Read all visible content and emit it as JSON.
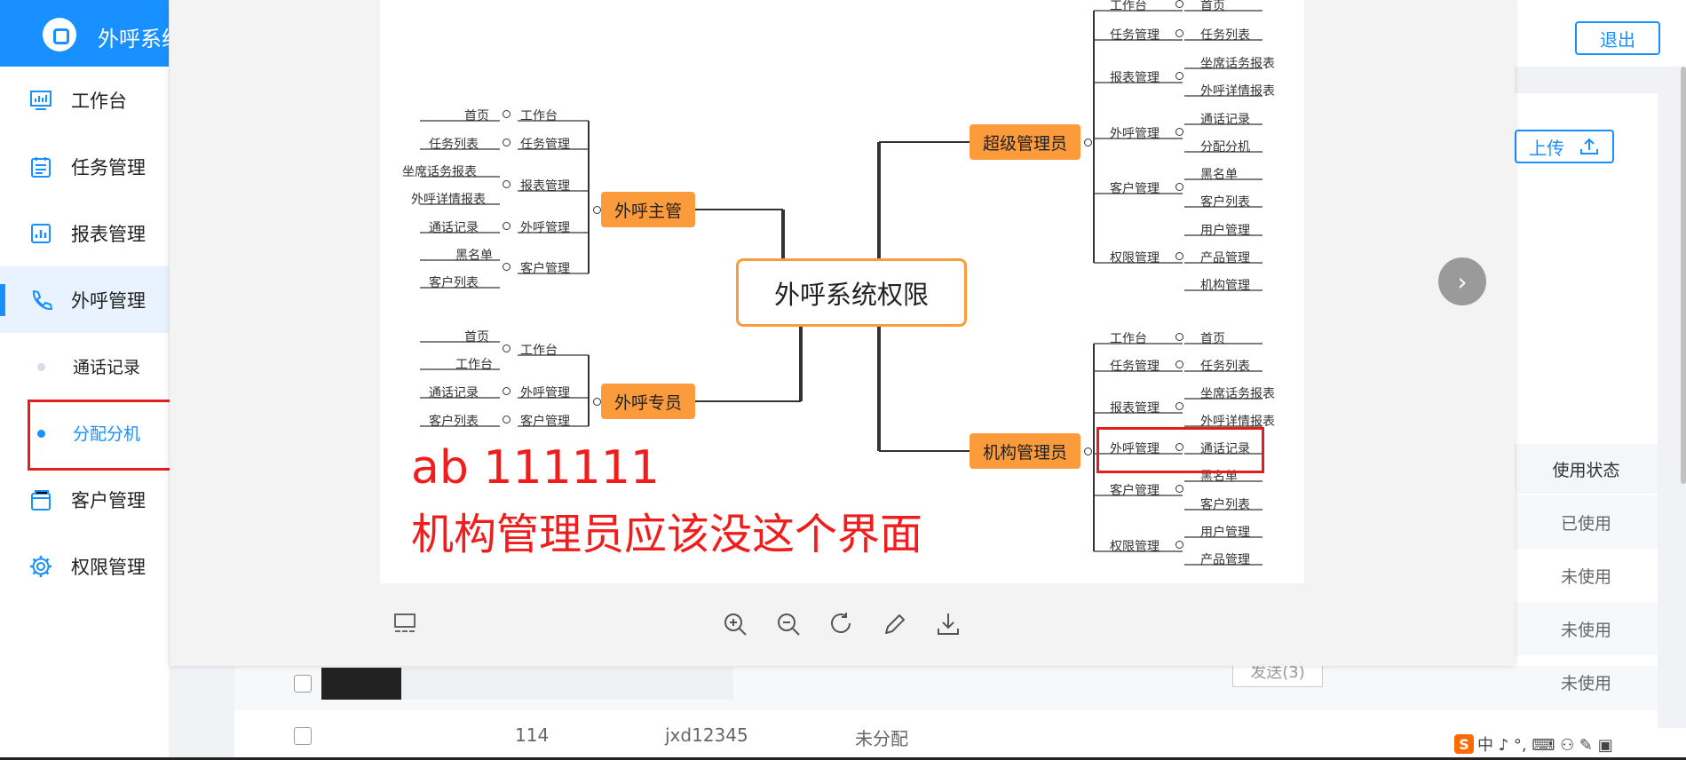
{
  "app": {
    "title": "外呼系统",
    "logout_label": "退出",
    "upload_label": "上传"
  },
  "sidebar": {
    "items": [
      {
        "label": "工作台",
        "icon": "dashboard-icon"
      },
      {
        "label": "任务管理",
        "icon": "task-icon"
      },
      {
        "label": "报表管理",
        "icon": "report-icon"
      },
      {
        "label": "外呼管理",
        "icon": "phone-icon"
      },
      {
        "label": "客户管理",
        "icon": "customer-icon"
      },
      {
        "label": "权限管理",
        "icon": "gear-icon"
      }
    ],
    "sub_items": [
      {
        "label": "通话记录"
      },
      {
        "label": "分配分机"
      }
    ]
  },
  "table": {
    "status_header": "使用状态",
    "status_values": [
      "已使用",
      "未使用",
      "未使用",
      "未使用"
    ],
    "row": {
      "id": "114",
      "account": "jxd12345",
      "assign": "未分配"
    },
    "send_label": "发送(3)"
  },
  "viewer": {
    "note_line1": "ab   111111",
    "note_line2": "机构管理员应该没这个界面",
    "next_icon": "chevron-right-icon",
    "toolbar": [
      "zoom-in-icon",
      "zoom-out-icon",
      "rotate-icon",
      "edit-icon",
      "download-icon"
    ]
  },
  "mindmap": {
    "root": "外呼系统权限",
    "supervisor": {
      "label": "外呼主管",
      "groups": [
        {
          "name": "工作台",
          "leaves": [
            "首页"
          ]
        },
        {
          "name": "任务管理",
          "leaves": [
            "任务列表"
          ]
        },
        {
          "name": "报表管理",
          "leaves": [
            "坐席话务报表",
            "外呼详情报表"
          ]
        },
        {
          "name": "外呼管理",
          "leaves": [
            "通话记录"
          ]
        },
        {
          "name": "客户管理",
          "leaves": [
            "黑名单",
            "客户列表"
          ]
        }
      ]
    },
    "specialist": {
      "label": "外呼专员",
      "groups": [
        {
          "name": "工作台",
          "leaves": [
            "首页",
            "工作台"
          ]
        },
        {
          "name": "外呼管理",
          "leaves": [
            "通话记录"
          ]
        },
        {
          "name": "客户管理",
          "leaves": [
            "客户列表"
          ]
        }
      ]
    },
    "super_admin": {
      "label": "超级管理员",
      "groups": [
        {
          "name": "工作台",
          "leaves": [
            "首页"
          ]
        },
        {
          "name": "任务管理",
          "leaves": [
            "任务列表"
          ]
        },
        {
          "name": "报表管理",
          "leaves": [
            "坐席话务报表",
            "外呼详情报表"
          ]
        },
        {
          "name": "外呼管理",
          "leaves": [
            "通话记录",
            "分配分机"
          ]
        },
        {
          "name": "客户管理",
          "leaves": [
            "黑名单",
            "客户列表"
          ]
        },
        {
          "name": "权限管理",
          "leaves": [
            "用户管理",
            "产品管理",
            "机构管理"
          ]
        }
      ]
    },
    "org_admin": {
      "label": "机构管理员",
      "groups": [
        {
          "name": "工作台",
          "leaves": [
            "首页"
          ]
        },
        {
          "name": "任务管理",
          "leaves": [
            "任务列表"
          ]
        },
        {
          "name": "报表管理",
          "leaves": [
            "坐席话务报表",
            "外呼详情报表"
          ]
        },
        {
          "name": "外呼管理",
          "leaves": [
            "通话记录"
          ]
        },
        {
          "name": "客户管理",
          "leaves": [
            "黑名单",
            "客户列表"
          ]
        },
        {
          "name": "权限管理",
          "leaves": [
            "用户管理",
            "产品管理"
          ]
        }
      ]
    }
  },
  "ime": {
    "chars": "中 ♪ °, ⌨ ⚇ ✎ ▣"
  }
}
